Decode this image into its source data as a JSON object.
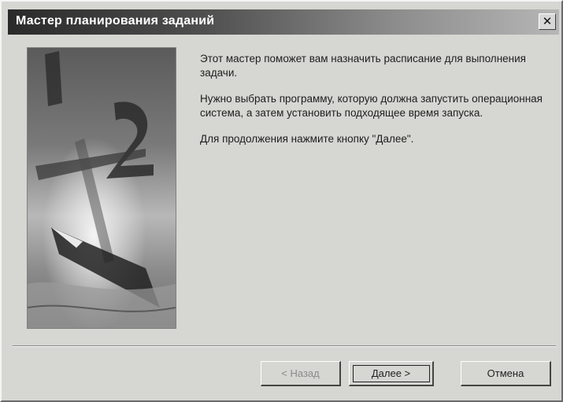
{
  "window": {
    "title": "Мастер планирования заданий",
    "close_glyph": "✕"
  },
  "content": {
    "paragraph1": "Этот мастер поможет вам назначить расписание для выполнения задачи.",
    "paragraph2": "Нужно выбрать программу, которую должна запустить операционная система, а затем установить подходящее время запуска.",
    "paragraph3": "Для продолжения нажмите кнопку \"Далее\"."
  },
  "buttons": {
    "back_label": "< Назад",
    "next_label": "Далее >",
    "cancel_label": "Отмена"
  },
  "wizard_image": {
    "icon": "clock-and-pen-illustration",
    "numerals": [
      "1",
      "2"
    ]
  },
  "colors": {
    "window_bg": "#d6d6d2",
    "title_text": "#ffffff",
    "disabled_text": "#8a8a8a"
  }
}
